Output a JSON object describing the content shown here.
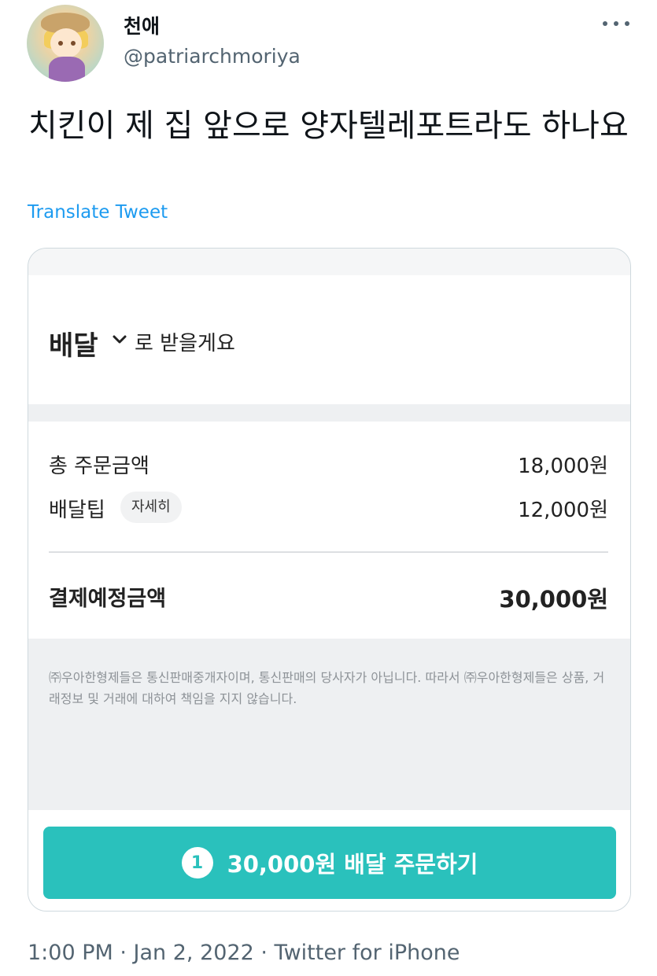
{
  "tweet": {
    "display_name": "천애",
    "handle": "@patriarchmoriya",
    "text": "치킨이 제 집 앞으로 양자텔레포트라도 하나요",
    "translate_label": "Translate Tweet",
    "timestamp": "1:00 PM · Jan 2, 2022 · Twitter for iPhone"
  },
  "icons": {
    "more": "more-horizontal-icon",
    "chevron": "chevron-down-icon"
  },
  "order_screen": {
    "delivery_method": "배달",
    "delivery_suffix": "로 받을게요",
    "rows": [
      {
        "label": "총 주문금액",
        "value": "18,000원"
      },
      {
        "label": "배달팁",
        "value": "12,000원",
        "chip": "자세히"
      }
    ],
    "total_label": "결제예정금액",
    "total_value": "30,000원",
    "disclaimer": "㈜우아한형제들은 통신판매중개자이며, 통신판매의 당사자가 아닙니다. 따라서 ㈜우아한형제들은 상품, 거래정보 및 거래에 대하여 책임을 지지 않습니다.",
    "order_count": "1",
    "order_button_label": "30,000원 배달 주문하기"
  },
  "colors": {
    "accent_teal": "#2ac1bc",
    "link_blue": "#1d9bf0",
    "muted_text": "#536471"
  }
}
